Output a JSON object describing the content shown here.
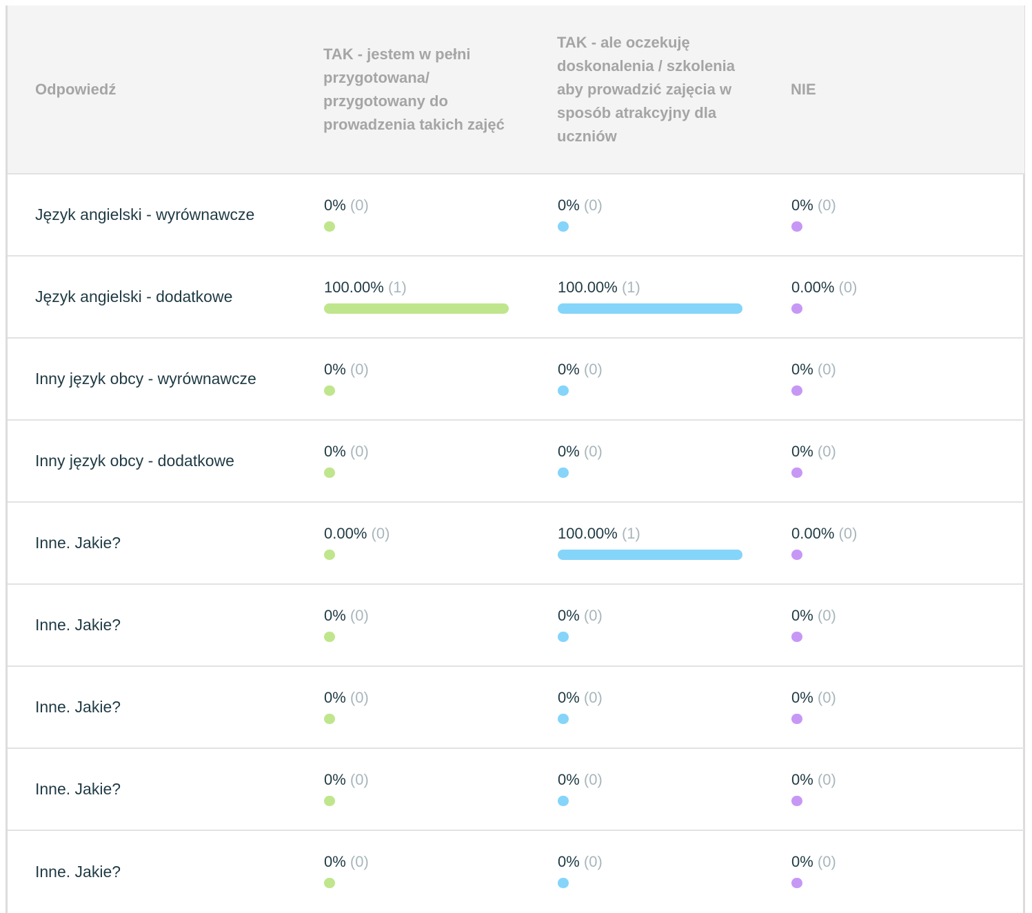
{
  "table": {
    "header": {
      "label": "Odpowiedź",
      "columns": [
        "TAK - jestem w pełni przygotowana/ przygotowany do prowadzenia takich zajęć",
        "TAK - ale oczekuję doskonalenia / szkolenia aby prowadzić zajęcia w sposób atrakcyjny dla uczniów",
        "NIE"
      ]
    },
    "colors": [
      "#bfe68c",
      "#85d4fa",
      "#c797f5"
    ],
    "rows": [
      {
        "label": "Język angielski - wyrównawcze",
        "cells": [
          {
            "percent": "0%",
            "count": "(0)",
            "fraction": 0
          },
          {
            "percent": "0%",
            "count": "(0)",
            "fraction": 0
          },
          {
            "percent": "0%",
            "count": "(0)",
            "fraction": 0
          }
        ]
      },
      {
        "label": "Język angielski - dodatkowe",
        "cells": [
          {
            "percent": "100.00%",
            "count": "(1)",
            "fraction": 1
          },
          {
            "percent": "100.00%",
            "count": "(1)",
            "fraction": 1
          },
          {
            "percent": "0.00%",
            "count": "(0)",
            "fraction": 0
          }
        ]
      },
      {
        "label": "Inny język obcy - wyrównawcze",
        "cells": [
          {
            "percent": "0%",
            "count": "(0)",
            "fraction": 0
          },
          {
            "percent": "0%",
            "count": "(0)",
            "fraction": 0
          },
          {
            "percent": "0%",
            "count": "(0)",
            "fraction": 0
          }
        ]
      },
      {
        "label": "Inny język obcy - dodatkowe",
        "cells": [
          {
            "percent": "0%",
            "count": "(0)",
            "fraction": 0
          },
          {
            "percent": "0%",
            "count": "(0)",
            "fraction": 0
          },
          {
            "percent": "0%",
            "count": "(0)",
            "fraction": 0
          }
        ]
      },
      {
        "label": "Inne. Jakie?",
        "cells": [
          {
            "percent": "0.00%",
            "count": "(0)",
            "fraction": 0
          },
          {
            "percent": "100.00%",
            "count": "(1)",
            "fraction": 1
          },
          {
            "percent": "0.00%",
            "count": "(0)",
            "fraction": 0
          }
        ]
      },
      {
        "label": "Inne. Jakie?",
        "cells": [
          {
            "percent": "0%",
            "count": "(0)",
            "fraction": 0
          },
          {
            "percent": "0%",
            "count": "(0)",
            "fraction": 0
          },
          {
            "percent": "0%",
            "count": "(0)",
            "fraction": 0
          }
        ]
      },
      {
        "label": "Inne. Jakie?",
        "cells": [
          {
            "percent": "0%",
            "count": "(0)",
            "fraction": 0
          },
          {
            "percent": "0%",
            "count": "(0)",
            "fraction": 0
          },
          {
            "percent": "0%",
            "count": "(0)",
            "fraction": 0
          }
        ]
      },
      {
        "label": "Inne. Jakie?",
        "cells": [
          {
            "percent": "0%",
            "count": "(0)",
            "fraction": 0
          },
          {
            "percent": "0%",
            "count": "(0)",
            "fraction": 0
          },
          {
            "percent": "0%",
            "count": "(0)",
            "fraction": 0
          }
        ]
      },
      {
        "label": "Inne. Jakie?",
        "cells": [
          {
            "percent": "0%",
            "count": "(0)",
            "fraction": 0
          },
          {
            "percent": "0%",
            "count": "(0)",
            "fraction": 0
          },
          {
            "percent": "0%",
            "count": "(0)",
            "fraction": 0
          }
        ]
      }
    ]
  }
}
